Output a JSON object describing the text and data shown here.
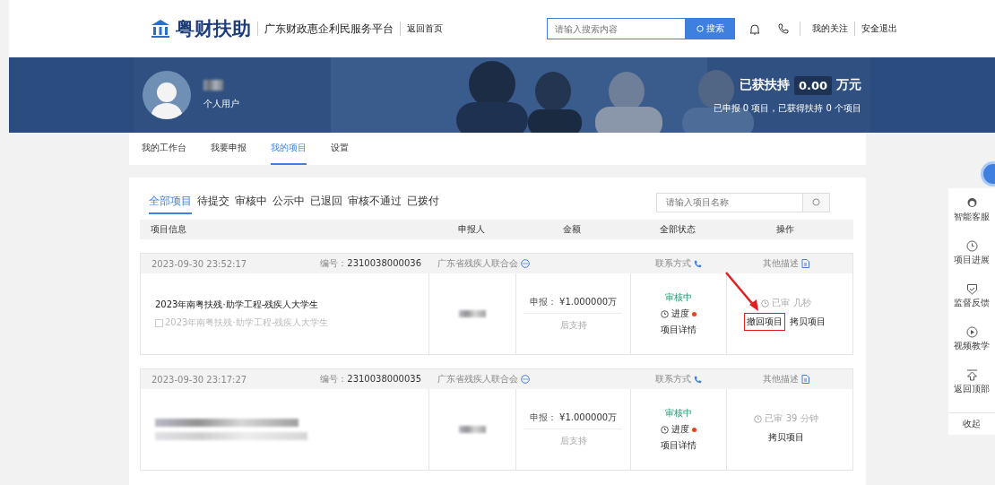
{
  "header": {
    "logo": "粤财扶助",
    "platform": "广东财政惠企利民服务平台",
    "home_link": "返回首页",
    "search": {
      "placeholder": "请输入搜索内容",
      "button": "搜索"
    },
    "links": [
      "我的关注",
      "安全退出"
    ]
  },
  "banner": {
    "user_type": "个人用户",
    "support_label": "已获扶持",
    "support_amount": "0.00",
    "support_unit": "万元",
    "summary": "已申报 0 项目，已获得扶持 0 个项目"
  },
  "nav_tabs": [
    {
      "label": "我的工作台",
      "selected": false
    },
    {
      "label": "我要申报",
      "selected": false
    },
    {
      "label": "我的项目",
      "selected": true
    },
    {
      "label": "设置",
      "selected": false
    }
  ],
  "filter_tabs": [
    {
      "label": "全部项目",
      "selected": true
    },
    {
      "label": "待提交",
      "selected": false
    },
    {
      "label": "审核中",
      "selected": false
    },
    {
      "label": "公示中",
      "selected": false
    },
    {
      "label": "已退回",
      "selected": false
    },
    {
      "label": "审核不通过",
      "selected": false
    },
    {
      "label": "已拨付",
      "selected": false
    }
  ],
  "project_search": {
    "placeholder": "请输入项目名称"
  },
  "table": {
    "columns": [
      "项目信息",
      "申报人",
      "金额",
      "全部状态",
      "操作"
    ],
    "rows": [
      {
        "time": "2023-09-30 23:52:17",
        "number_label": "编号：",
        "number": "2310038000036",
        "org": "广东省残疾人联合会",
        "contact": "联系方式",
        "other": "其他描述",
        "title": "2023年南粤扶残·助学工程-残疾人大学生",
        "subtitle": "2023年南粤扶残·助学工程-残疾人大学生",
        "amount_label": "申报：",
        "amount": "¥1.000000万",
        "after": "后支持",
        "status": "审核中",
        "progress": "进度",
        "detail": "项目详情",
        "elapsed": "已审 几秒",
        "actions": [
          "撤回项目",
          "拷贝项目"
        ],
        "highlighted": true
      },
      {
        "time": "2023-09-30 23:17:27",
        "number_label": "编号：",
        "number": "2310038000035",
        "org": "广东省残疾人联合会",
        "contact": "联系方式",
        "other": "其他描述",
        "title_blurred": true,
        "amount_label": "申报：",
        "amount": "¥1.000000万",
        "after": "后支持",
        "status": "审核中",
        "progress": "进度",
        "detail": "项目详情",
        "elapsed": "已审 39 分钟",
        "actions": [
          "拷贝项目"
        ],
        "highlighted": false
      }
    ]
  },
  "side_tools": [
    "智能客服",
    "项目进展",
    "监督反馈",
    "视频教学",
    "返回顶部"
  ],
  "side_collapse": "收起"
}
